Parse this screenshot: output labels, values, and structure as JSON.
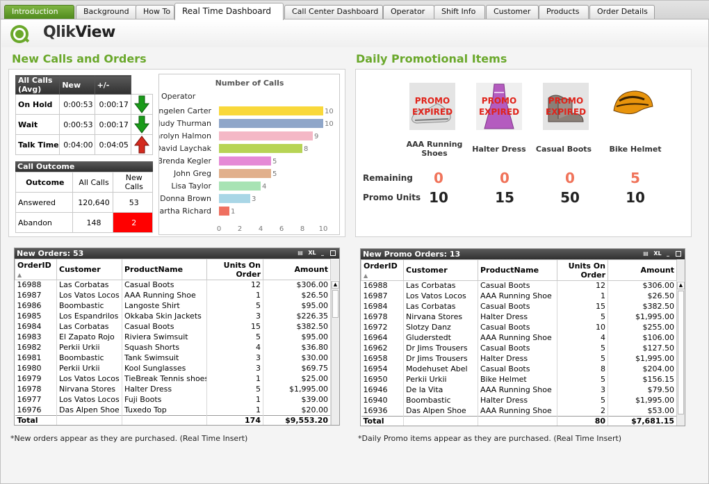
{
  "tabs": [
    "Introduction",
    "Background",
    "How To",
    "Real Time Dashboard",
    "Call Center Dashboard",
    "Operator",
    "Shift Info",
    "Customer",
    "Products",
    "Order Details"
  ],
  "logo": {
    "text_qlik": "Qlik",
    "text_view": "View"
  },
  "left": {
    "title": "New Calls and Orders",
    "kpi": {
      "headers": [
        "All Calls (Avg)",
        "New",
        "+/-"
      ],
      "rows": [
        {
          "label": "On Hold",
          "all": "0:00:53",
          "new": "0:00:17",
          "trend": "down-arrow-icon"
        },
        {
          "label": "Wait",
          "all": "0:00:53",
          "new": "0:00:17",
          "trend": "down-arrow-icon"
        },
        {
          "label": "Talk Time",
          "all": "0:04:00",
          "new": "0:04:05",
          "trend": "up-arrow-icon"
        }
      ]
    },
    "outcome": {
      "caption": "Call Outcome",
      "headers": [
        "Outcome",
        "All Calls",
        "New Calls"
      ],
      "rows": [
        {
          "label": "Answered",
          "all": "120,640",
          "new": "53"
        },
        {
          "label": "Abandon",
          "all": "148",
          "new": "2"
        }
      ],
      "alert_color": "#ff0000"
    },
    "chart_data": {
      "type": "bar",
      "title": "Number of Calls",
      "dim_label": "Operator",
      "categories": [
        "Angelen Carter",
        "Judy Thurman",
        "Carolyn Halmon",
        "David Laychak",
        "Brenda Kegler",
        "John Greg",
        "Lisa Taylor",
        "Donna Brown",
        "Martha Richard"
      ],
      "values": [
        10,
        10,
        9,
        8,
        5,
        5,
        4,
        3,
        1
      ],
      "colors": [
        "#f9d83a",
        "#8fa6c9",
        "#f4b8c6",
        "#b7d455",
        "#e58ad6",
        "#e1b08c",
        "#a8e3b4",
        "#a9d6e6",
        "#ef7060"
      ],
      "xlim": [
        0,
        10
      ],
      "xticks": [
        "0",
        "2",
        "4",
        "6",
        "8",
        "10"
      ]
    },
    "orders": {
      "caption": "New Orders: 53",
      "columns": [
        "OrderID",
        "Customer",
        "ProductName",
        "Units On Order",
        "Amount"
      ],
      "rows": [
        [
          "16988",
          "Las Corbatas",
          "Casual Boots",
          "12",
          "$306.00"
        ],
        [
          "16987",
          "Los Vatos Locos",
          "AAA Running Shoe",
          "1",
          "$26.50"
        ],
        [
          "16986",
          "Boombastic",
          "Langoste Shirt",
          "5",
          "$95.00"
        ],
        [
          "16985",
          "Los Espandrilos ...",
          "Okkaba Skin Jackets",
          "3",
          "$226.35"
        ],
        [
          "16984",
          "Las Corbatas",
          "Casual Boots",
          "15",
          "$382.50"
        ],
        [
          "16983",
          "El Zapato Rojo",
          "Riviera Swimsuit",
          "5",
          "$95.00"
        ],
        [
          "16982",
          "Perkii Urkii",
          "Squash Shorts",
          "4",
          "$36.80"
        ],
        [
          "16981",
          "Boombastic",
          "Tank Swimsuit",
          "3",
          "$30.00"
        ],
        [
          "16980",
          "Perkii Urkii",
          "Kool Sunglasses",
          "3",
          "$69.75"
        ],
        [
          "16979",
          "Los Vatos Locos",
          "TieBreak Tennis shoes",
          "1",
          "$25.00"
        ],
        [
          "16978",
          "Nirvana Stores",
          "Halter Dress",
          "5",
          "$1,995.00"
        ],
        [
          "16977",
          "Los Vatos Locos",
          "Fuji Boots",
          "1",
          "$39.00"
        ],
        [
          "16976",
          "Das Alpen Shoe",
          "Tuxedo Top",
          "1",
          "$20.00"
        ]
      ],
      "total": {
        "label": "Total",
        "units": "174",
        "amount": "$9,553.20"
      }
    },
    "note": "*New orders appear as they are purchased. (Real Time Insert)"
  },
  "right": {
    "title": "Daily Promotional Items",
    "expired_text": "PROMO EXPIRED",
    "row_labels": {
      "remaining": "Remaining",
      "units": "Promo Units"
    },
    "items": [
      {
        "name": "AAA Running Shoes",
        "remaining": "0",
        "units": "10",
        "expired": true,
        "icon": "running-shoe-icon"
      },
      {
        "name": "Halter Dress",
        "remaining": "0",
        "units": "15",
        "expired": true,
        "icon": "dress-icon"
      },
      {
        "name": "Casual Boots",
        "remaining": "0",
        "units": "50",
        "expired": true,
        "icon": "boots-icon"
      },
      {
        "name": "Bike Helmet",
        "remaining": "5",
        "units": "10",
        "expired": false,
        "icon": "helmet-icon"
      }
    ],
    "remaining_color": "#f0735a",
    "orders": {
      "caption": "New Promo Orders: 13",
      "columns": [
        "OrderID",
        "Customer",
        "ProductName",
        "Units On Order",
        "Amount"
      ],
      "rows": [
        [
          "16988",
          "Las Corbatas",
          "Casual Boots",
          "12",
          "$306.00"
        ],
        [
          "16987",
          "Los Vatos Locos",
          "AAA Running Shoe",
          "1",
          "$26.50"
        ],
        [
          "16984",
          "Las Corbatas",
          "Casual Boots",
          "15",
          "$382.50"
        ],
        [
          "16978",
          "Nirvana Stores",
          "Halter Dress",
          "5",
          "$1,995.00"
        ],
        [
          "16972",
          "Slotzy Danz",
          "Casual Boots",
          "10",
          "$255.00"
        ],
        [
          "16964",
          "Gluderstedt",
          "AAA Running Shoe",
          "4",
          "$106.00"
        ],
        [
          "16962",
          "Dr Jims Trousers",
          "Casual Boots",
          "5",
          "$127.50"
        ],
        [
          "16958",
          "Dr Jims Trousers",
          "Halter Dress",
          "5",
          "$1,995.00"
        ],
        [
          "16954",
          "Modehuset Abel",
          "Casual Boots",
          "8",
          "$204.00"
        ],
        [
          "16950",
          "Perkii Urkii",
          "Bike Helmet",
          "5",
          "$156.15"
        ],
        [
          "16946",
          "De la Vita",
          "AAA Running Shoe",
          "3",
          "$79.50"
        ],
        [
          "16940",
          "Boombastic",
          "Halter Dress",
          "5",
          "$1,995.00"
        ],
        [
          "16936",
          "Das Alpen Shoe",
          "AAA Running Shoe",
          "2",
          "$53.00"
        ]
      ],
      "total": {
        "label": "Total",
        "units": "80",
        "amount": "$7,681.15"
      }
    },
    "note": "*Daily Promo items appear as they are purchased. (Real Time Insert)"
  },
  "table_icons": [
    "print-icon",
    "xl-icon",
    "minimize-icon",
    "maximize-icon"
  ],
  "xl_label": "XL"
}
